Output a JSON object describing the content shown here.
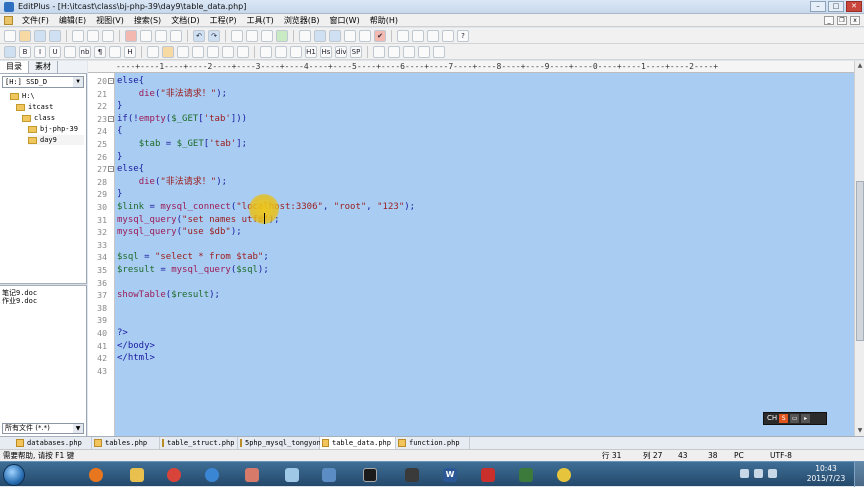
{
  "window": {
    "title": "EditPlus - [H:\\itcast\\class\\bj-php-39\\day9\\table_data.php]",
    "btn_min": "–",
    "btn_max": "□",
    "btn_close": "✕"
  },
  "menu": [
    "文件(F)",
    "编辑(E)",
    "视图(V)",
    "搜索(S)",
    "文档(D)",
    "工程(P)",
    "工具(T)",
    "浏览器(B)",
    "窗口(W)",
    "帮助(H)"
  ],
  "toolbar2_labels": {
    "bold": "B",
    "italic": "I",
    "underline": "U",
    "nbsp": "nb",
    "para": "¶",
    "h": "H",
    "h1": "H1",
    "div": "div",
    "sp": "SP",
    "hs": "Hs"
  },
  "left_panel": {
    "tabs": [
      "目录",
      "素材"
    ],
    "drive": "[H:] SSD_D",
    "tree": [
      "H:\\",
      "itcast",
      "class",
      "bj-php-39",
      "day9"
    ],
    "files": [
      "笔记9.doc",
      "作业9.doc"
    ],
    "filter": "所有文件 (*.*)"
  },
  "ruler": "----+----1----+----2----+----3----+----4----+----5----+----6----+----7----+----8----+----9----+----0----+----1----+----2----+",
  "editor": {
    "lines": [
      {
        "n": "20",
        "fold": true,
        "parts": [
          {
            "c": "kw",
            "t": "else{"
          }
        ]
      },
      {
        "n": "21",
        "parts": [
          {
            "c": "",
            "t": "    "
          },
          {
            "c": "fn",
            "t": "die"
          },
          {
            "c": "pun",
            "t": "("
          },
          {
            "c": "str",
            "t": "\"非法请求！\""
          },
          {
            "c": "pun",
            "t": ");"
          }
        ]
      },
      {
        "n": "22",
        "parts": [
          {
            "c": "kw",
            "t": "}"
          }
        ]
      },
      {
        "n": "23",
        "fold": true,
        "parts": [
          {
            "c": "kw",
            "t": "if(!"
          },
          {
            "c": "fn",
            "t": "empty"
          },
          {
            "c": "pun",
            "t": "("
          },
          {
            "c": "var",
            "t": "$_GET"
          },
          {
            "c": "pun",
            "t": "["
          },
          {
            "c": "str",
            "t": "'tab'"
          },
          {
            "c": "pun",
            "t": "]))"
          }
        ]
      },
      {
        "n": "24",
        "parts": [
          {
            "c": "kw",
            "t": "{"
          }
        ]
      },
      {
        "n": "25",
        "parts": [
          {
            "c": "",
            "t": "    "
          },
          {
            "c": "var",
            "t": "$tab"
          },
          {
            "c": "pun",
            "t": " = "
          },
          {
            "c": "var",
            "t": "$_GET"
          },
          {
            "c": "pun",
            "t": "["
          },
          {
            "c": "str",
            "t": "'tab'"
          },
          {
            "c": "pun",
            "t": "];"
          }
        ]
      },
      {
        "n": "26",
        "parts": [
          {
            "c": "kw",
            "t": "}"
          }
        ]
      },
      {
        "n": "27",
        "fold": true,
        "parts": [
          {
            "c": "kw",
            "t": "else{"
          }
        ]
      },
      {
        "n": "28",
        "parts": [
          {
            "c": "",
            "t": "    "
          },
          {
            "c": "fn",
            "t": "die"
          },
          {
            "c": "pun",
            "t": "("
          },
          {
            "c": "str",
            "t": "\"非法请求！\""
          },
          {
            "c": "pun",
            "t": ");"
          }
        ]
      },
      {
        "n": "29",
        "parts": [
          {
            "c": "kw",
            "t": "}"
          }
        ]
      },
      {
        "n": "30",
        "parts": [
          {
            "c": "var",
            "t": "$link"
          },
          {
            "c": "pun",
            "t": " = "
          },
          {
            "c": "fn",
            "t": "mysql_connect"
          },
          {
            "c": "pun",
            "t": "("
          },
          {
            "c": "str",
            "t": "\"localhost:3306\""
          },
          {
            "c": "pun",
            "t": ", "
          },
          {
            "c": "str",
            "t": "\"root\""
          },
          {
            "c": "pun",
            "t": ", "
          },
          {
            "c": "str",
            "t": "\"123\""
          },
          {
            "c": "pun",
            "t": ");"
          }
        ]
      },
      {
        "n": "31",
        "parts": [
          {
            "c": "fn",
            "t": "mysql_query"
          },
          {
            "c": "pun",
            "t": "("
          },
          {
            "c": "str",
            "t": "\"set names utf8\""
          },
          {
            "c": "pun",
            "t": ");"
          }
        ]
      },
      {
        "n": "32",
        "parts": [
          {
            "c": "fn",
            "t": "mysql_query"
          },
          {
            "c": "pun",
            "t": "("
          },
          {
            "c": "str",
            "t": "\"use $db\""
          },
          {
            "c": "pun",
            "t": ");"
          }
        ]
      },
      {
        "n": "33",
        "parts": []
      },
      {
        "n": "34",
        "parts": [
          {
            "c": "var",
            "t": "$sql"
          },
          {
            "c": "pun",
            "t": " = "
          },
          {
            "c": "str",
            "t": "\"select * from $tab\""
          },
          {
            "c": "pun",
            "t": ";"
          }
        ]
      },
      {
        "n": "35",
        "parts": [
          {
            "c": "var",
            "t": "$result"
          },
          {
            "c": "pun",
            "t": " = "
          },
          {
            "c": "fn",
            "t": "mysql_query"
          },
          {
            "c": "pun",
            "t": "("
          },
          {
            "c": "var",
            "t": "$sql"
          },
          {
            "c": "pun",
            "t": ");"
          }
        ]
      },
      {
        "n": "36",
        "parts": []
      },
      {
        "n": "37",
        "parts": [
          {
            "c": "fn",
            "t": "showTable"
          },
          {
            "c": "pun",
            "t": "("
          },
          {
            "c": "var",
            "t": "$result"
          },
          {
            "c": "pun",
            "t": ");"
          }
        ]
      },
      {
        "n": "38",
        "parts": []
      },
      {
        "n": "39",
        "parts": []
      },
      {
        "n": "40",
        "parts": [
          {
            "c": "kw",
            "t": "?>"
          }
        ]
      },
      {
        "n": "41",
        "parts": [
          {
            "c": "kw",
            "t": "</body>"
          }
        ]
      },
      {
        "n": "42",
        "parts": [
          {
            "c": "kw",
            "t": "</html>"
          }
        ]
      },
      {
        "n": "43",
        "parts": []
      }
    ]
  },
  "ime": {
    "lang": "CH",
    "s": "S"
  },
  "doc_tabs": [
    "databases.php",
    "tables.php",
    "table_struct.php",
    "5php_mysql_tongyon",
    "table_data.php",
    "function.php"
  ],
  "active_doc_tab": 4,
  "status": {
    "help": "需要帮助, 请按 F1 键",
    "row": "行 31",
    "col": "列 27",
    "n1": "43",
    "n2": "38",
    "mode": "PC",
    "enc": "UTF-8"
  },
  "taskbar": {
    "time": "10:43",
    "date": "2015/7/23"
  },
  "colors": {
    "editor_bg": "#a9cdf2",
    "cursor_highlight": "#ebc20f",
    "taskbar": "#24496b"
  }
}
